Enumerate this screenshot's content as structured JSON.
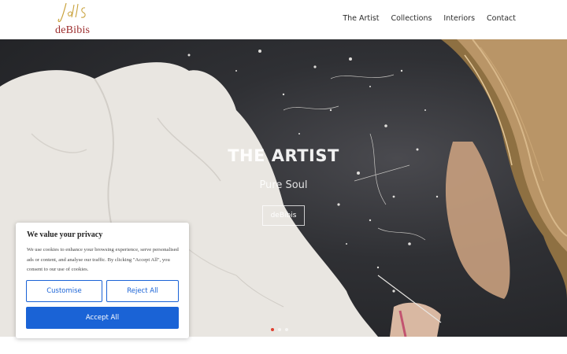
{
  "brand": {
    "script": "JeBS",
    "wordmark": "deBibis"
  },
  "nav": {
    "items": [
      "The Artist",
      "Collections",
      "Interiors",
      "Contact"
    ]
  },
  "hero": {
    "title": "THE ARTIST",
    "subtitle": "Pure Soul",
    "button": "deBibis",
    "slides": 3,
    "active_slide": 1
  },
  "cookie": {
    "title": "We value your privacy",
    "text": "We use cookies to enhance your browsing experience, serve personalised ads or content, and analyse our traffic. By clicking \"Accept All\", you consent to our use of cookies.",
    "customise": "Customise",
    "reject": "Reject All",
    "accept": "Accept All"
  },
  "colors": {
    "accent": "#1a63d6",
    "brand": "#9c2d2d",
    "gold": "#c9a23c"
  }
}
